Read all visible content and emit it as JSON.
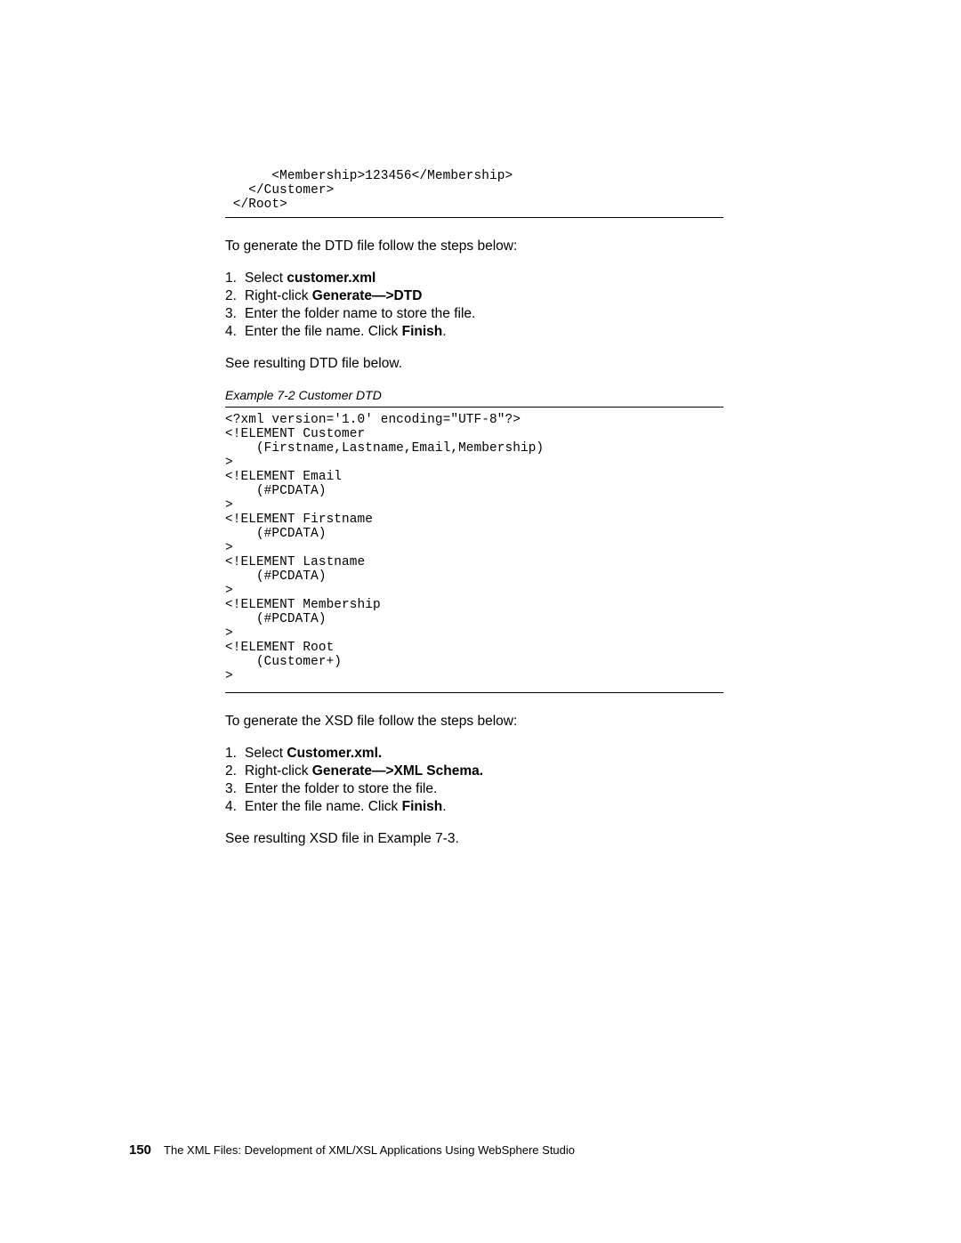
{
  "code_block_top": "      <Membership>123456</Membership>\n   </Customer>\n </Root>",
  "intro_dtd": "To generate the DTD file follow the steps below:",
  "steps_dtd": {
    "s1_pre": "Select ",
    "s1_bold": "customer.xml",
    "s2_pre": "Right-click ",
    "s2_bold": "Generate—>DTD",
    "s3": "Enter the folder name to store the file.",
    "s4_pre": "Enter the file name. Click ",
    "s4_bold": "Finish",
    "s4_post": "."
  },
  "see_dtd": "See resulting DTD file below.",
  "example_caption": "Example 7-2   Customer DTD",
  "code_dtd": "<?xml version='1.0' encoding=\"UTF-8\"?>\n<!ELEMENT Customer\n    (Firstname,Lastname,Email,Membership)\n>\n<!ELEMENT Email\n    (#PCDATA)\n>\n<!ELEMENT Firstname\n    (#PCDATA)\n>\n<!ELEMENT Lastname\n    (#PCDATA)\n>\n<!ELEMENT Membership\n    (#PCDATA)\n>\n<!ELEMENT Root\n    (Customer+)\n>",
  "intro_xsd": "To generate the XSD file follow the steps below:",
  "steps_xsd": {
    "s1_pre": "Select ",
    "s1_bold": "Customer.xml.",
    "s2_pre": "Right-click ",
    "s2_bold": "Generate—>XML Schema.",
    "s3": "Enter the folder to store the file.",
    "s4_pre": "Enter the file name. Click ",
    "s4_bold": "Finish",
    "s4_post": "."
  },
  "see_xsd": "See resulting XSD file in Example 7-3.",
  "footer": {
    "page_number": "150",
    "running": "The XML Files:  Development of XML/XSL Applications Using WebSphere Studio"
  }
}
